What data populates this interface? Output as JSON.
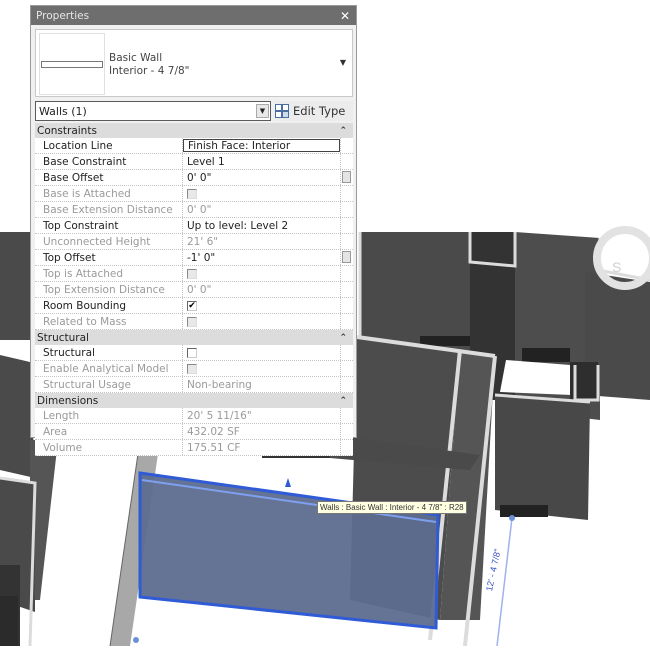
{
  "properties_panel": {
    "title": "Properties",
    "close_icon": "close-icon",
    "type_selector": {
      "family": "Basic Wall",
      "type": "Interior - 4 7/8\""
    },
    "instance_filter": {
      "selected": "Walls (1)"
    },
    "edit_type_label": "Edit Type",
    "sections": [
      {
        "name": "Constraints",
        "rows": [
          {
            "label": "Location Line",
            "value": "Finish Face: Interior",
            "enabled": true,
            "kind": "text",
            "editing": true
          },
          {
            "label": "Base Constraint",
            "value": "Level 1",
            "enabled": true,
            "kind": "text"
          },
          {
            "label": "Base Offset",
            "value": "0'  0\"",
            "enabled": true,
            "kind": "text"
          },
          {
            "label": "Base is Attached",
            "value": "",
            "enabled": false,
            "kind": "checkbox",
            "checked": false
          },
          {
            "label": "Base Extension Distance",
            "value": "0'  0\"",
            "enabled": false,
            "kind": "text"
          },
          {
            "label": "Top Constraint",
            "value": "Up to level: Level 2",
            "enabled": true,
            "kind": "text"
          },
          {
            "label": "Unconnected Height",
            "value": "21'  6\"",
            "enabled": false,
            "kind": "text"
          },
          {
            "label": "Top Offset",
            "value": "-1'  0\"",
            "enabled": true,
            "kind": "text"
          },
          {
            "label": "Top is Attached",
            "value": "",
            "enabled": false,
            "kind": "checkbox",
            "checked": false
          },
          {
            "label": "Top Extension Distance",
            "value": "0'  0\"",
            "enabled": false,
            "kind": "text"
          },
          {
            "label": "Room Bounding",
            "value": "",
            "enabled": true,
            "kind": "checkbox",
            "checked": true
          },
          {
            "label": "Related to Mass",
            "value": "",
            "enabled": false,
            "kind": "checkbox",
            "checked": false
          }
        ]
      },
      {
        "name": "Structural",
        "rows": [
          {
            "label": "Structural",
            "value": "",
            "enabled": true,
            "kind": "checkbox",
            "checked": false
          },
          {
            "label": "Enable Analytical Model",
            "value": "",
            "enabled": false,
            "kind": "checkbox",
            "checked": false
          },
          {
            "label": "Structural Usage",
            "value": "Non-bearing",
            "enabled": false,
            "kind": "text"
          }
        ]
      },
      {
        "name": "Dimensions",
        "rows": [
          {
            "label": "Length",
            "value": "20'  5 11/16\"",
            "enabled": false,
            "kind": "text"
          },
          {
            "label": "Area",
            "value": "432.02 SF",
            "enabled": false,
            "kind": "text"
          },
          {
            "label": "Volume",
            "value": "175.51 CF",
            "enabled": false,
            "kind": "text"
          }
        ]
      }
    ]
  },
  "viewport": {
    "tooltip": "Walls : Basic Wall : Interior - 4 7/8\" : R28",
    "dimension_label": "12' - 4 7/8\"",
    "colors": {
      "wall_dark": "#4a4a4a",
      "wall_top": "#d8d8d8",
      "selection": "#2f5bd6",
      "selection_fill": "#5d6c8e"
    }
  }
}
